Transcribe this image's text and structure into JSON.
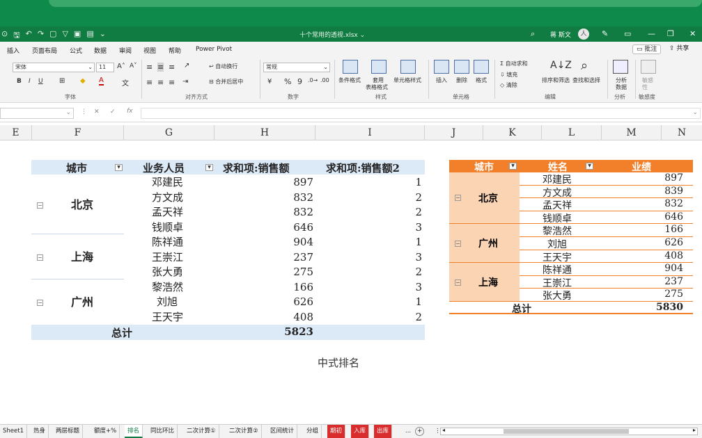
{
  "titlebar": {
    "doc_title": "十个常用的透视.xlsx ⌄",
    "user": "蒋 斯文",
    "avatar": "人"
  },
  "menu": {
    "tabs": [
      "插入",
      "页面布局",
      "公式",
      "数据",
      "审阅",
      "视图",
      "帮助",
      "Power Pivot"
    ],
    "comment_btn": "批注",
    "share_btn": "共享"
  },
  "ribbon": {
    "font_name": "宋体",
    "font_size": "11",
    "grow_font": "A˄",
    "shrink_font": "A˅",
    "bold": "B",
    "italic": "I",
    "underline": "U",
    "wrap": "自动换行",
    "merge": "合并后居中",
    "number_format": "常规",
    "percent": "%",
    "comma": "9",
    "cond_format": "条件格式",
    "table_format_1": "套用",
    "table_format_2": "表格格式",
    "cell_style": "单元格样式",
    "insert": "插入",
    "delete": "删除",
    "format": "格式",
    "autosum": "自动求和",
    "fill": "填充",
    "clear": "清除",
    "sort": "排序和筛选",
    "find": "查找和选择",
    "analyze_1": "分析",
    "analyze_2": "数据",
    "sensitivity_1": "敏感",
    "sensitivity_2": "性",
    "groups": {
      "font": "字体",
      "alignment": "对齐方式",
      "number": "数字",
      "styles": "样式",
      "cells": "单元格",
      "editing": "编辑",
      "analysis": "分析",
      "sensitivity": "敏感度"
    }
  },
  "formula_bar": {
    "fx": "fx",
    "cancel": "✕",
    "enter": "✓"
  },
  "columns": [
    "E",
    "F",
    "G",
    "H",
    "I",
    "J",
    "K",
    "L",
    "M",
    "N"
  ],
  "pivot1": {
    "headers": [
      "城市",
      "业务人员",
      "求和项:销售额",
      "求和项:销售额2"
    ],
    "groups": [
      {
        "city": "北京",
        "rows": [
          [
            "邓建民",
            "897",
            "1"
          ],
          [
            "方文成",
            "832",
            "2"
          ],
          [
            "孟天祥",
            "832",
            "2"
          ],
          [
            "钱顺卓",
            "646",
            "3"
          ]
        ]
      },
      {
        "city": "上海",
        "rows": [
          [
            "陈祥通",
            "904",
            "1"
          ],
          [
            "王崇江",
            "237",
            "3"
          ],
          [
            "张大勇",
            "275",
            "2"
          ]
        ]
      },
      {
        "city": "广州",
        "rows": [
          [
            "黎浩然",
            "166",
            "3"
          ],
          [
            "刘旭",
            "626",
            "1"
          ],
          [
            "王天宇",
            "408",
            "2"
          ]
        ]
      }
    ],
    "total_label": "总计",
    "total_value": "5823"
  },
  "caption": "中式排名",
  "pivot2": {
    "headers": [
      "城市",
      "姓名",
      "业绩"
    ],
    "groups": [
      {
        "city": "北京",
        "rows": [
          [
            "邓建民",
            "897"
          ],
          [
            "方文成",
            "839"
          ],
          [
            "孟天祥",
            "832"
          ],
          [
            "钱顺卓",
            "646"
          ]
        ]
      },
      {
        "city": "广州",
        "rows": [
          [
            "黎浩然",
            "166"
          ],
          [
            "刘旭",
            "626"
          ],
          [
            "王天宇",
            "408"
          ]
        ]
      },
      {
        "city": "上海",
        "rows": [
          [
            "陈祥通",
            "904"
          ],
          [
            "王崇江",
            "237"
          ],
          [
            "张大勇",
            "275"
          ]
        ]
      }
    ],
    "total_label": "总计",
    "total_value": "5830"
  },
  "sheet_tabs": [
    {
      "label": "Sheet1",
      "state": "normal"
    },
    {
      "label": "热身",
      "state": "normal"
    },
    {
      "label": "两层标题",
      "state": "normal"
    },
    {
      "label": "额度+%",
      "state": "normal"
    },
    {
      "label": "排名",
      "state": "active"
    },
    {
      "label": "同比环比",
      "state": "normal"
    },
    {
      "label": "二次计算①",
      "state": "normal"
    },
    {
      "label": "二次计算②",
      "state": "normal"
    },
    {
      "label": "区间统计",
      "state": "normal"
    },
    {
      "label": "分组",
      "state": "normal"
    },
    {
      "label": "期初",
      "state": "red"
    },
    {
      "label": "入库",
      "state": "red"
    },
    {
      "label": "出库",
      "state": "red"
    }
  ],
  "sheet_more": "...",
  "sheet_add": "+",
  "colors": {
    "excel_green": "#107c41",
    "pivot_blue": "#dce9f7",
    "pivot_orange": "#f2802a",
    "pivot_peach": "#fbd4b4"
  }
}
